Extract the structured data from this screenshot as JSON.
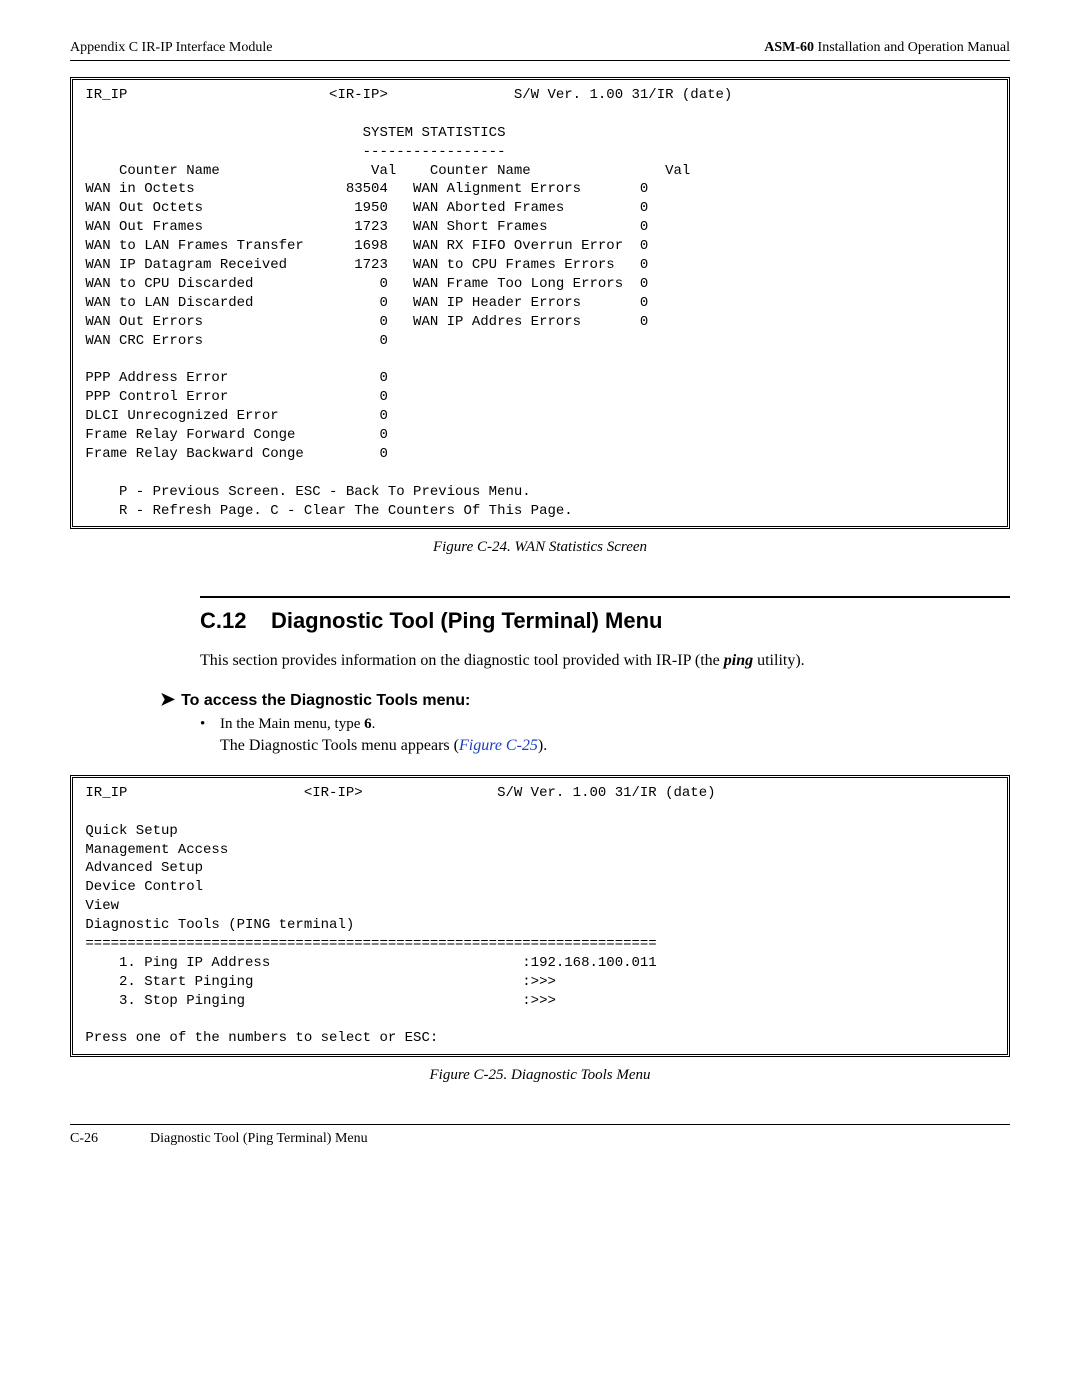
{
  "header": {
    "left": "Appendix C  IR-IP Interface Module",
    "right_bold": "ASM-60",
    "right_rest": " Installation and Operation Manual"
  },
  "term1": {
    "row1_left": "IR_IP",
    "row1_mid": "<IR-IP>",
    "row1_right": "S/W Ver. 1.00 31/IR (date)",
    "title": "SYSTEM STATISTICS",
    "dashes": "-----------------",
    "hdr_left_name": "Counter Name",
    "hdr_left_val": "Val",
    "hdr_right_name": "Counter Name",
    "hdr_right_val": "Val",
    "rows_left": [
      {
        "name": "WAN in Octets",
        "val": "83504"
      },
      {
        "name": "WAN Out Octets",
        "val": "1950"
      },
      {
        "name": "WAN Out Frames",
        "val": "1723"
      },
      {
        "name": "WAN to LAN Frames Transfer",
        "val": "1698"
      },
      {
        "name": "WAN IP Datagram Received",
        "val": "1723"
      },
      {
        "name": "WAN to CPU Discarded",
        "val": "0"
      },
      {
        "name": "WAN to LAN Discarded",
        "val": "0"
      },
      {
        "name": "WAN Out Errors",
        "val": "0"
      },
      {
        "name": "WAN CRC Errors",
        "val": "0"
      }
    ],
    "rows_right": [
      {
        "name": "WAN Alignment Errors",
        "val": "0"
      },
      {
        "name": "WAN Aborted Frames",
        "val": "0"
      },
      {
        "name": "WAN Short Frames",
        "val": "0"
      },
      {
        "name": "WAN RX FIFO Overrun Error",
        "val": "0"
      },
      {
        "name": "WAN to CPU Frames Errors",
        "val": "0"
      },
      {
        "name": "WAN Frame Too Long Errors",
        "val": "0"
      },
      {
        "name": "WAN IP Header Errors",
        "val": "0"
      },
      {
        "name": "WAN IP Addres Errors",
        "val": "0"
      }
    ],
    "rows_bottom": [
      {
        "name": "PPP Address Error",
        "val": "0"
      },
      {
        "name": "PPP Control Error",
        "val": "0"
      },
      {
        "name": "DLCI Unrecognized Error",
        "val": "0"
      },
      {
        "name": "Frame Relay Forward Conge",
        "val": "0"
      },
      {
        "name": "Frame Relay Backward Conge",
        "val": "0"
      }
    ],
    "nav1": "P - Previous Screen. ESC - Back To Previous Menu.",
    "nav2": "R - Refresh Page. C - Clear The Counters Of This Page."
  },
  "caption1": "Figure C-24.  WAN Statistics Screen",
  "section": {
    "num": "C.12",
    "title": "Diagnostic Tool (Ping Terminal) Menu",
    "para": "This section provides information on the diagnostic tool provided with IR-IP (the ",
    "ping_word": "ping",
    "para_end": " utility).",
    "proc_head": "To access the Diagnostic Tools menu:",
    "bullet1_pre": "In the Main menu, type ",
    "bullet1_bold": "6",
    "bullet1_post": ".",
    "subtext_pre": "The Diagnostic Tools menu appears (",
    "figref": "Figure C-25",
    "subtext_post": ")."
  },
  "term2": {
    "row1_left": "IR_IP",
    "row1_mid": "<IR-IP>",
    "row1_right": "S/W Ver. 1.00 31/IR (date)",
    "menu_items": [
      "Quick Setup",
      "Management Access",
      "Advanced Setup",
      "Device Control",
      "View",
      "Diagnostic Tools (PING terminal)"
    ],
    "eqline": "====================================================================",
    "opts": [
      {
        "n": "1",
        "label": "Ping IP Address",
        "val": ":192.168.100.011"
      },
      {
        "n": "2",
        "label": "Start Pinging",
        "val": ":>>>"
      },
      {
        "n": "3",
        "label": "Stop Pinging",
        "val": ":>>>"
      }
    ],
    "prompt": "Press one of the numbers to select or ESC:"
  },
  "caption2": "Figure C-25.  Diagnostic Tools Menu",
  "footer": {
    "left": "C-26",
    "right": "Diagnostic Tool (Ping Terminal) Menu"
  }
}
